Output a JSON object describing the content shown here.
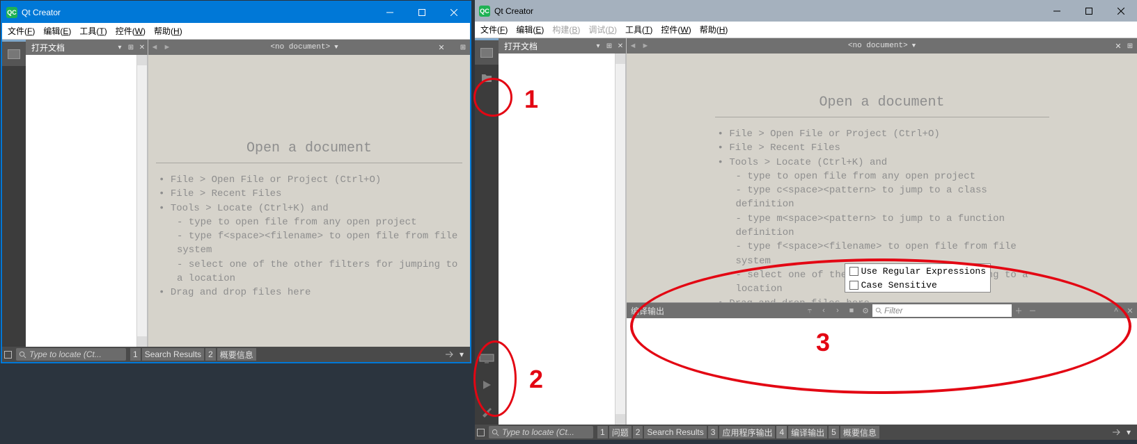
{
  "app": "Qt Creator",
  "left": {
    "title": "Qt Creator",
    "menu": [
      "文件(F)",
      "编辑(E)",
      "工具(T)",
      "控件(W)",
      "帮助(H)"
    ],
    "openDocs": "打开文档",
    "noDoc": "<no document>",
    "help": {
      "title": "Open a document",
      "lines": [
        {
          "t": "bul",
          "v": "File > Open File or Project (Ctrl+O)"
        },
        {
          "t": "bul",
          "v": "File > Recent Files"
        },
        {
          "t": "bul",
          "v": "Tools > Locate (Ctrl+K) and"
        },
        {
          "t": "sub",
          "v": "type to open file from any open project"
        },
        {
          "t": "sub",
          "v": "type f<space><filename> to open file from file system"
        },
        {
          "t": "sub",
          "v": "select one of the other filters for jumping to a location"
        },
        {
          "t": "bul",
          "v": "Drag and drop files here"
        }
      ]
    },
    "locator": "Type to locate (Ct...",
    "panes": [
      {
        "num": "1",
        "label": "Search Results"
      },
      {
        "num": "2",
        "label": "概要信息"
      }
    ]
  },
  "right": {
    "title": "Qt Creator",
    "menu": [
      {
        "label": "文件(F)",
        "disabled": false
      },
      {
        "label": "编辑(E)",
        "disabled": false
      },
      {
        "label": "构建(B)",
        "disabled": true
      },
      {
        "label": "调试(D)",
        "disabled": true
      },
      {
        "label": "工具(T)",
        "disabled": false
      },
      {
        "label": "控件(W)",
        "disabled": false
      },
      {
        "label": "帮助(H)",
        "disabled": false
      }
    ],
    "openDocs": "打开文档",
    "noDoc": "<no document>",
    "help": {
      "title": "Open a document",
      "lines": [
        {
          "t": "bul",
          "v": "File > Open File or Project (Ctrl+O)"
        },
        {
          "t": "bul",
          "v": "File > Recent Files"
        },
        {
          "t": "bul",
          "v": "Tools > Locate (Ctrl+K) and"
        },
        {
          "t": "sub",
          "v": "type to open file from any open project"
        },
        {
          "t": "sub",
          "v": "type c<space><pattern> to jump to a class definition"
        },
        {
          "t": "sub",
          "v": "type m<space><pattern> to jump to a function definition"
        },
        {
          "t": "sub",
          "v": "type f<space><filename> to open file from file system"
        },
        {
          "t": "sub",
          "v": "select one of the other filters for jumping to a location"
        },
        {
          "t": "bul",
          "v": "Drag and drop files here"
        }
      ]
    },
    "popup": [
      "Use Regular Expressions",
      "Case Sensitive"
    ],
    "output": {
      "title": "编译输出",
      "filter": "Filter"
    },
    "locator": "Type to locate (Ct...",
    "panes": [
      {
        "num": "1",
        "label": "问题"
      },
      {
        "num": "2",
        "label": "Search Results"
      },
      {
        "num": "3",
        "label": "应用程序输出"
      },
      {
        "num": "4",
        "label": "编译输出",
        "active": true
      },
      {
        "num": "5",
        "label": "概要信息"
      }
    ]
  },
  "annotations": {
    "a1": "1",
    "a2": "2",
    "a3": "3"
  }
}
